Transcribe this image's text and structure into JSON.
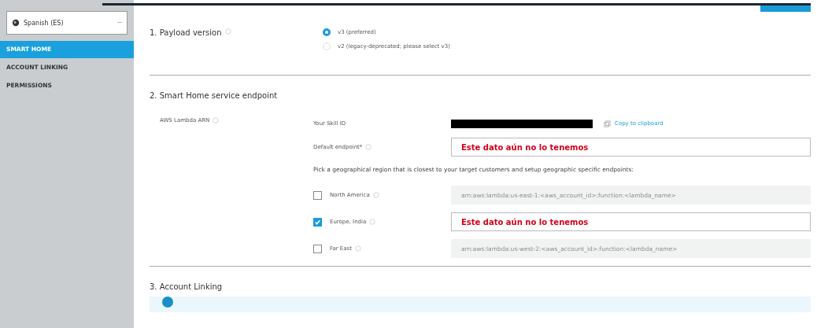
{
  "language_select": {
    "value": "Spanish (ES)"
  },
  "sidebar": {
    "items": [
      {
        "label": "SMART HOME",
        "selected": true
      },
      {
        "label": "ACCOUNT LINKING",
        "selected": false
      },
      {
        "label": "PERMISSIONS",
        "selected": false
      }
    ]
  },
  "payload_version": {
    "title": "1. Payload version",
    "options": [
      {
        "label": "v3 (preferred)",
        "selected": true
      },
      {
        "label": "v2 (legacy-deprecated; please select v3)",
        "selected": false
      }
    ]
  },
  "endpoint": {
    "title": "2. Smart Home service endpoint",
    "arn_label": "AWS Lambda ARN",
    "skill_id_label": "Your Skill ID",
    "copy_link": "Copy to clipboard",
    "default_label": "Default endpoint*",
    "default_value": "Este dato aún no lo tenemos",
    "region_hint": "Pick a geographical region that is closest to your target customers and setup geographic specific endpoints:",
    "regions": [
      {
        "label": "North America",
        "checked": false,
        "placeholder": "arn:aws:lambda:us-east-1:<aws_account_id>:function:<lambda_name>"
      },
      {
        "label": "Europe, India",
        "checked": true,
        "value": "Este dato aún no lo tenemos"
      },
      {
        "label": "Far East",
        "checked": false,
        "placeholder": "arn:aws:lambda:us-west-2:<aws_account_id>:function:<lambda_name>"
      }
    ]
  },
  "account_linking": {
    "title": "3. Account Linking"
  }
}
